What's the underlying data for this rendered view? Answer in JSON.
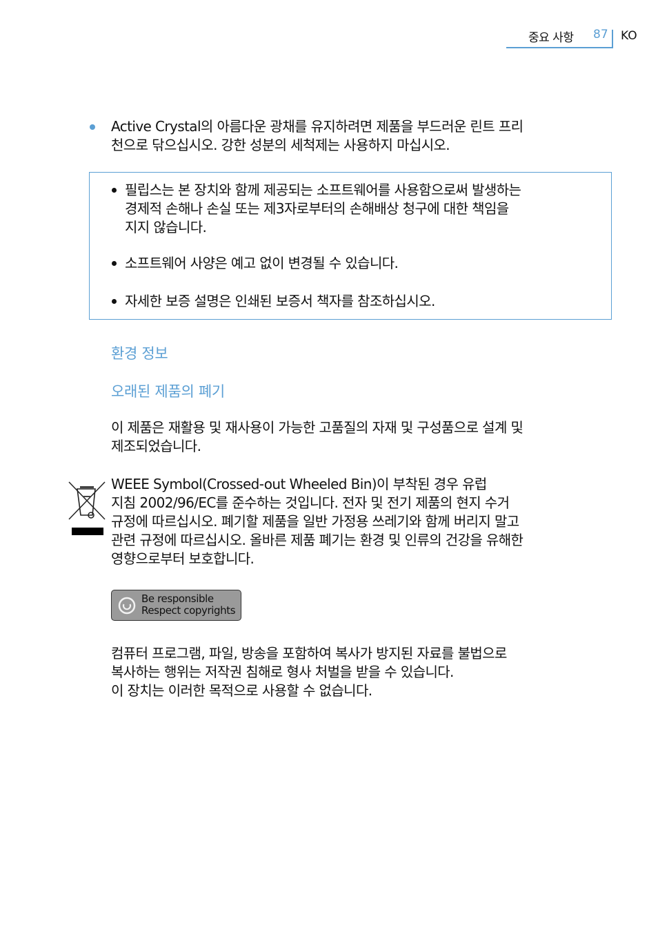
{
  "header": {
    "section": "중요 사항",
    "page_number": "87",
    "language": "KO",
    "accent_color": "#5b9fd4"
  },
  "care_bullet": {
    "lines": [
      "Active Crystal의 아름다운 광채를 유지하려면 제품을 부드러운 린트 프리",
      "천으로 닦으십시오. 강한 성분의 세척제는 사용하지 마십시오."
    ]
  },
  "notice_box": {
    "items": [
      {
        "lines": [
          "필립스는 본 장치와 함께 제공되는 소프트웨어를 사용함으로써 발생하는",
          "경제적 손해나 손실 또는 제3자로부터의 손해배상 청구에 대한 책임을",
          "지지 않습니다."
        ]
      },
      {
        "lines": [
          "소프트웨어 사양은 예고 없이 변경될 수 있습니다."
        ]
      },
      {
        "lines": [
          "자세한 보증 설명은 인쇄된 보증서 책자를 참조하십시오."
        ]
      }
    ]
  },
  "environment": {
    "heading": "환경 정보",
    "subheading": "오래된 제품의 폐기",
    "recycle_paragraph": [
      "이 제품은 재활용 및 재사용이 가능한 고품질의 자재 및 구성품으로 설계 및",
      "제조되었습니다."
    ],
    "weee_icon": "crossed-out-wheeled-bin-icon",
    "weee_paragraph": [
      "WEEE Symbol(Crossed-out Wheeled Bin)이 부착된 경우 유럽",
      "지침 2002/96/EC를 준수하는 것입니다. 전자 및 전기 제품의 현지 수거",
      "규정에 따르십시오. 폐기할 제품을 일반 가정용 쓰레기와 함께 버리지 말고",
      "관련 규정에 따르십시오. 올바른 제품 폐기는 환경 및 인류의 건강을 유해한",
      "영향으로부터 보호합니다."
    ]
  },
  "copyright": {
    "badge_line1": "Be responsible",
    "badge_line2": "Respect copyrights",
    "badge_icon": "power-circle-icon",
    "paragraph": [
      "컴퓨터 프로그램, 파일, 방송을 포함하여 복사가 방지된 자료를 불법으로",
      "복사하는 행위는 저작권 침해로 형사 처벌을 받을 수 있습니다.",
      "이 장치는 이러한 목적으로 사용할 수 없습니다."
    ]
  }
}
